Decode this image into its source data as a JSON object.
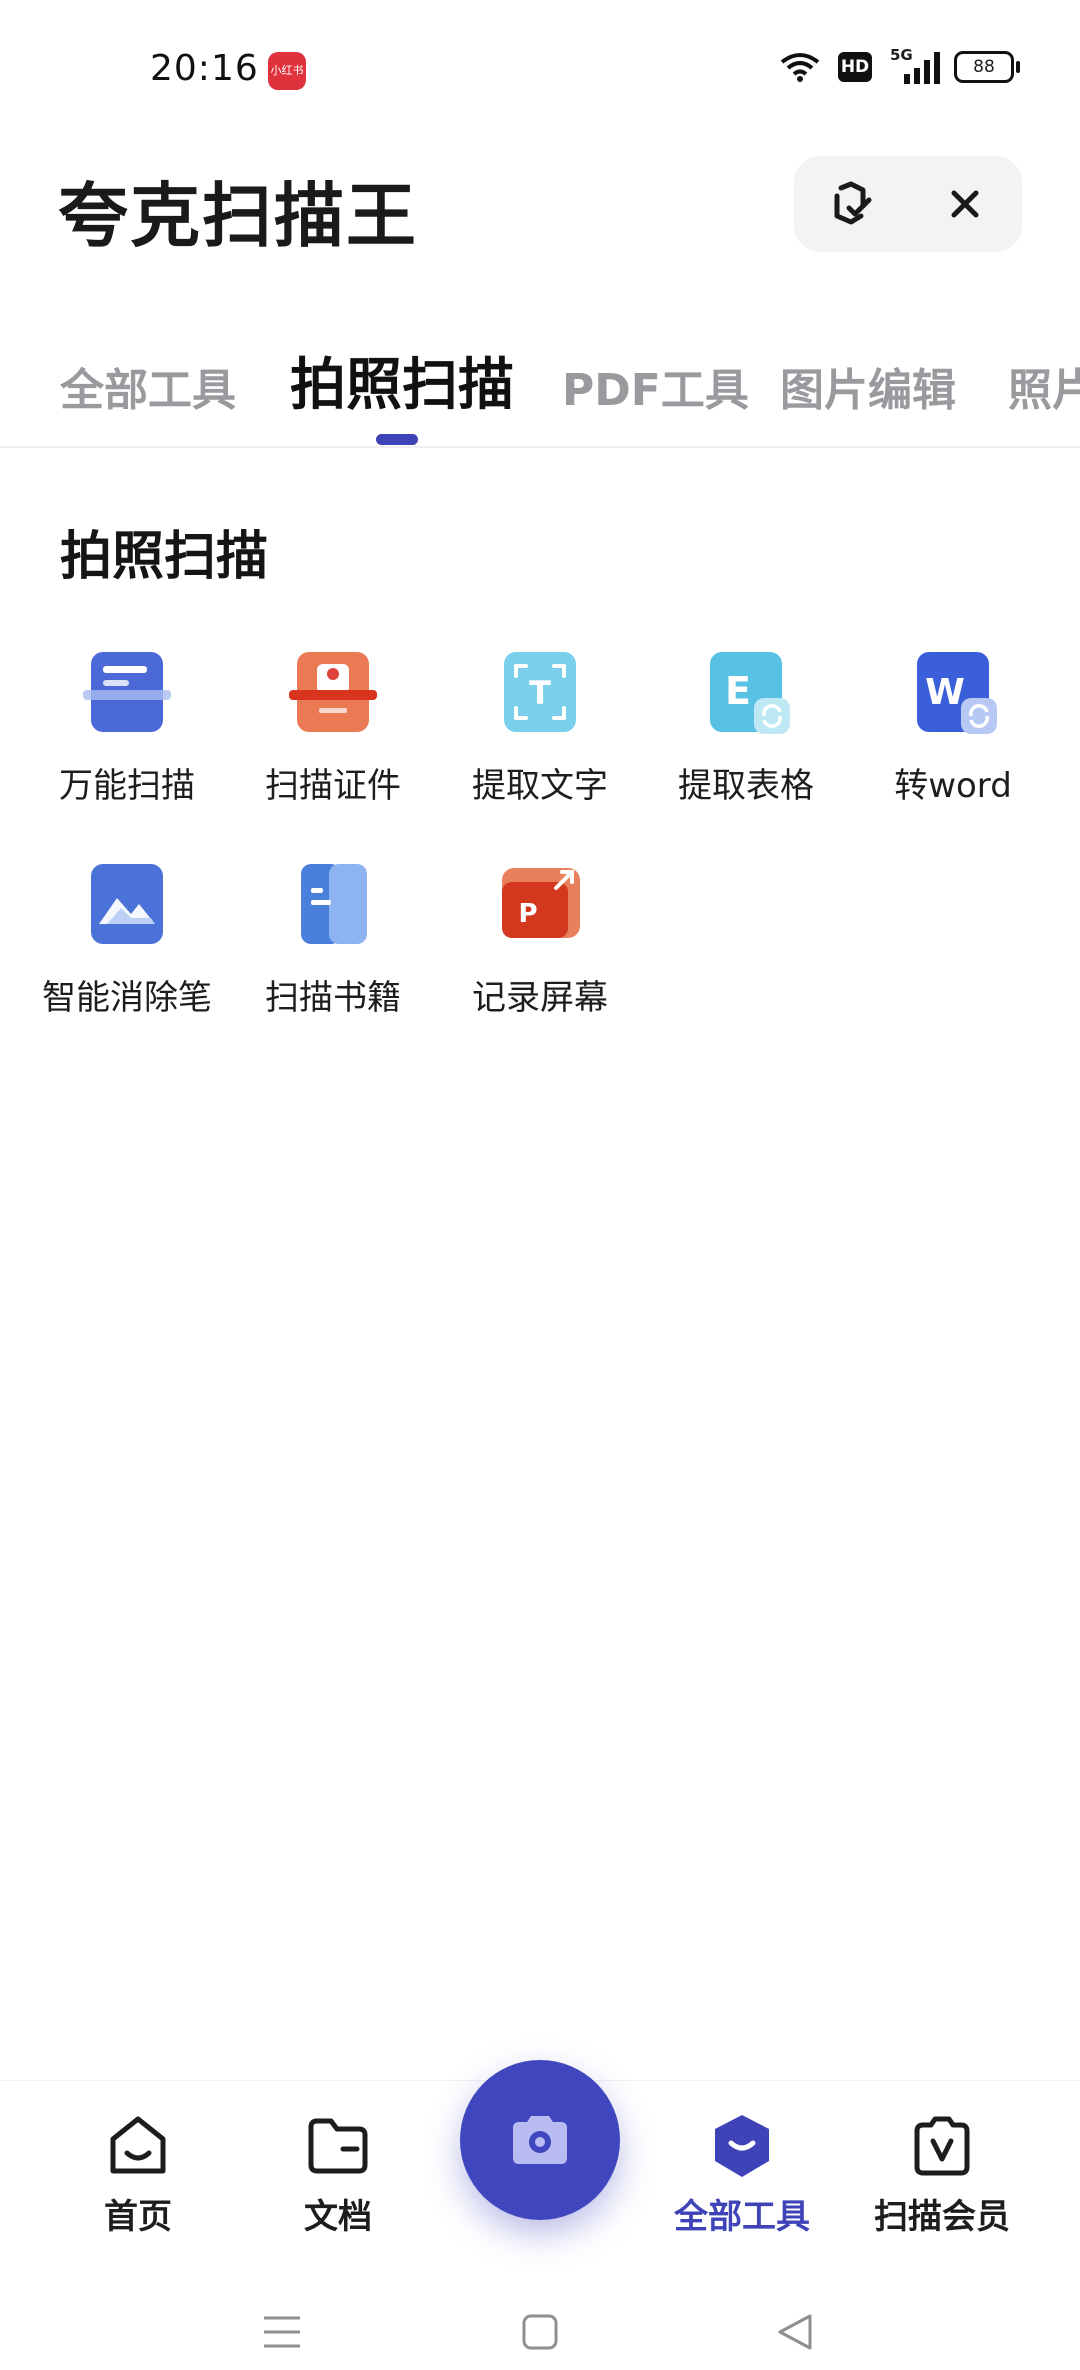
{
  "status_bar": {
    "time": "20:16",
    "app_badge": "小红书",
    "hd": "HD",
    "network": "5G",
    "battery": "88"
  },
  "header": {
    "title": "夸克扫描王",
    "sync_icon": "cloud-check-icon",
    "close_icon": "close-icon"
  },
  "tabs": [
    {
      "label": "全部工具",
      "active": false
    },
    {
      "label": "拍照扫描",
      "active": true
    },
    {
      "label": "PDF工具",
      "active": false
    },
    {
      "label": "图片编辑",
      "active": false
    },
    {
      "label": "照片",
      "active": false
    }
  ],
  "section": {
    "title": "拍照扫描",
    "tools": [
      {
        "label": "万能扫描",
        "icon": "universal-scan-icon"
      },
      {
        "label": "扫描证件",
        "icon": "id-scan-icon"
      },
      {
        "label": "提取文字",
        "icon": "extract-text-icon"
      },
      {
        "label": "提取表格",
        "icon": "extract-table-icon"
      },
      {
        "label": "转word",
        "icon": "to-word-icon"
      },
      {
        "label": "智能消除笔",
        "icon": "smart-eraser-icon"
      },
      {
        "label": "扫描书籍",
        "icon": "scan-book-icon"
      },
      {
        "label": "记录屏幕",
        "icon": "record-screen-icon"
      }
    ]
  },
  "bottom_nav": {
    "items": [
      {
        "label": "首页",
        "icon": "home-icon",
        "active": false
      },
      {
        "label": "文档",
        "icon": "folder-icon",
        "active": false
      },
      {
        "label": "全部工具",
        "icon": "all-tools-icon",
        "active": true
      },
      {
        "label": "扫描会员",
        "icon": "vip-icon",
        "active": false
      }
    ],
    "camera_icon": "camera-icon"
  },
  "colors": {
    "accent": "#3f43b8",
    "inactive_tab": "#9a9a9e"
  }
}
